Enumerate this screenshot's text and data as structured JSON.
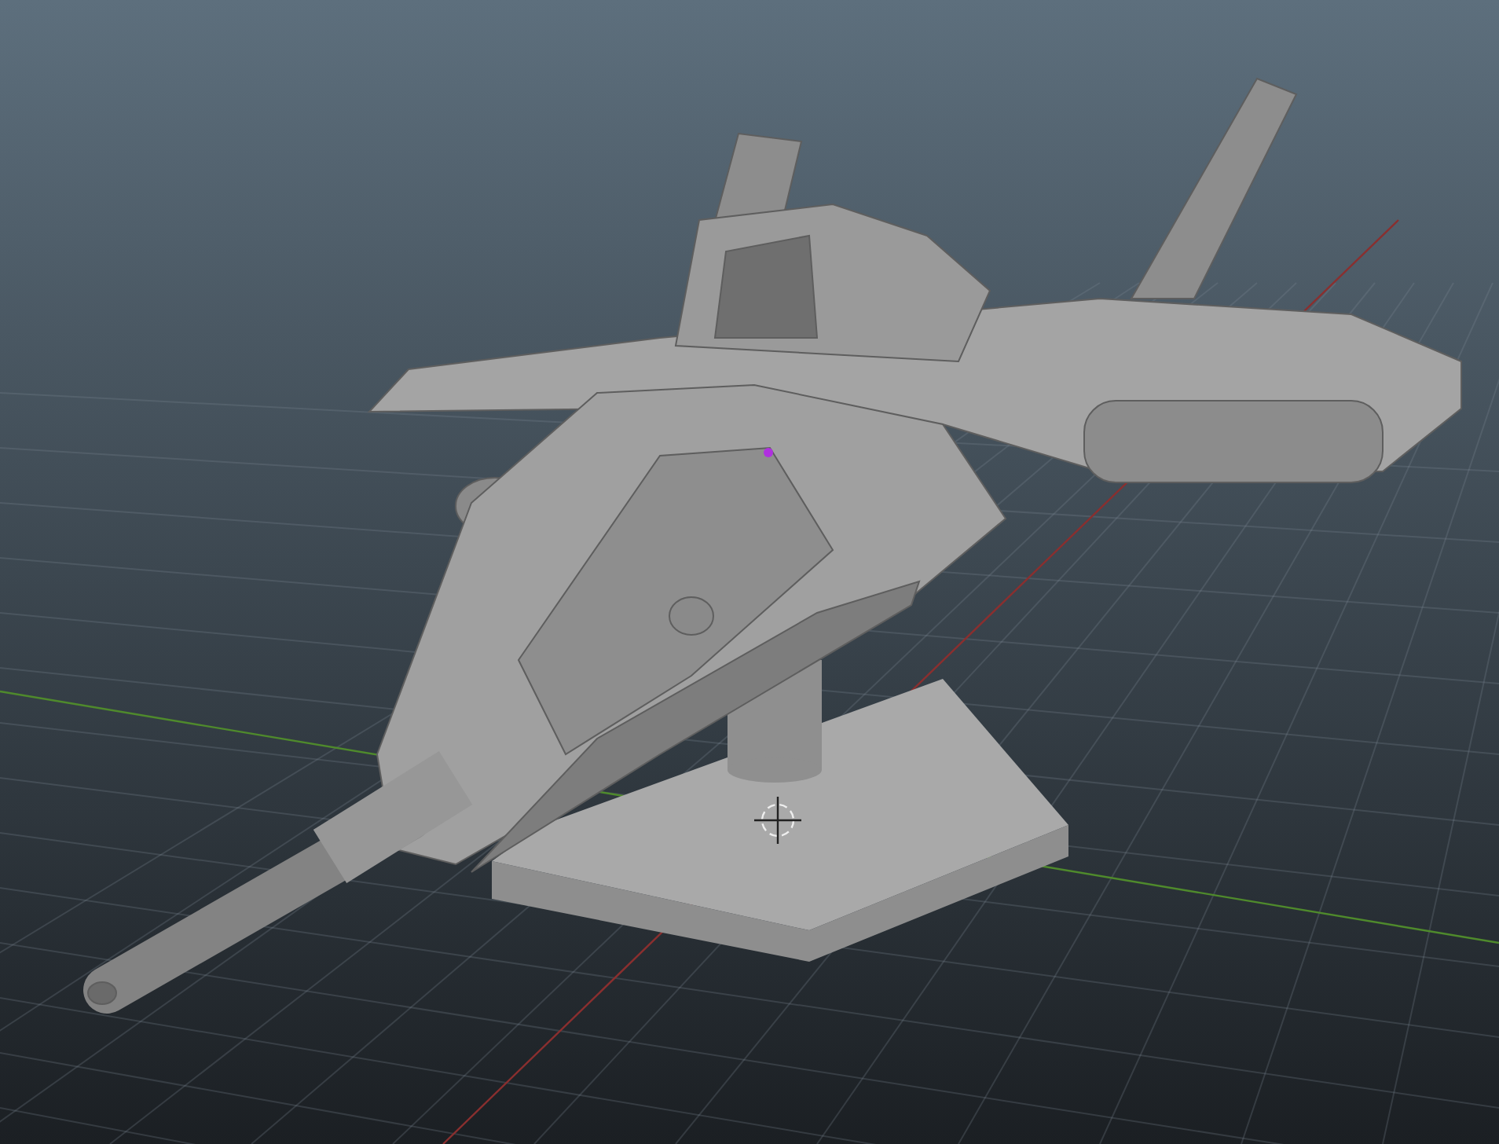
{
  "viewport": {
    "grid_visible": true,
    "axes_visible": true,
    "pivot_visible": true,
    "vertex_selected": true
  }
}
